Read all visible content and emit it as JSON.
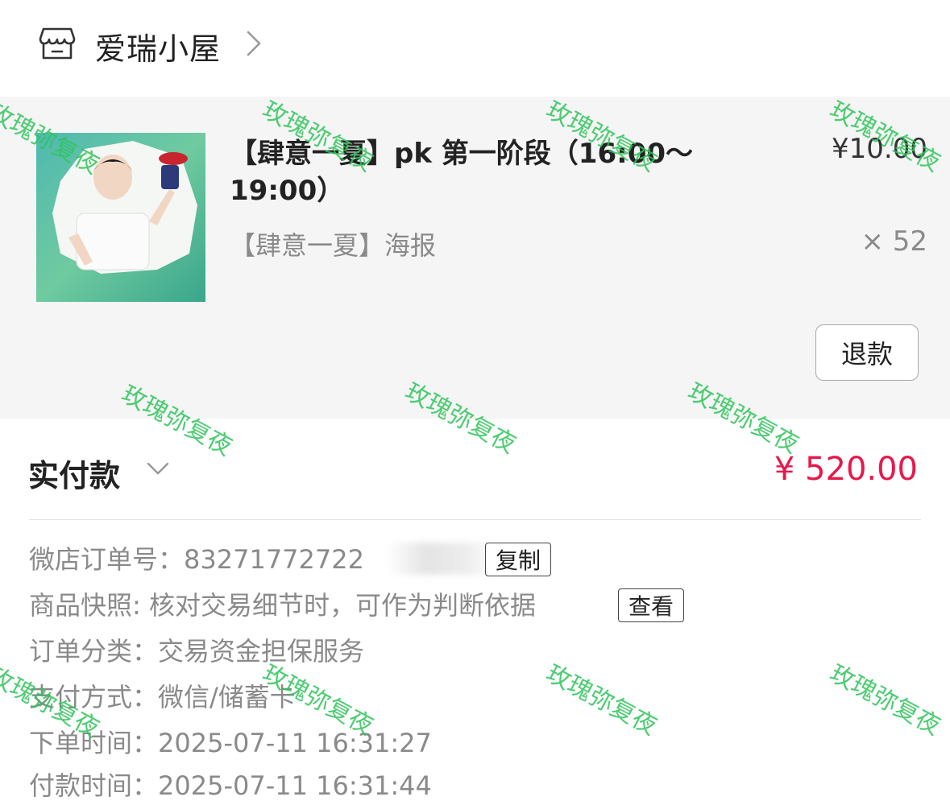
{
  "shop": {
    "name": "爱瑞小屋"
  },
  "product": {
    "title": "【肆意一夏】pk 第一阶段（16:00～19:00）",
    "price": "¥10.00",
    "spec": "【肆意一夏】海报",
    "quantity": "× 52",
    "refund_label": "退款"
  },
  "payment": {
    "label": "实付款",
    "amount": "¥ 520.00"
  },
  "order_info": {
    "order_no_label": "微店订单号：",
    "order_no_value": "83271772722",
    "copy_label": "复制",
    "snapshot_label": "商品快照:",
    "snapshot_value": "核对交易细节时，可作为判断依据",
    "view_label": "查看",
    "category_label": "订单分类：",
    "category_value": "交易资金担保服务",
    "pay_method_label": "支付方式：",
    "pay_method_value": "微信/储蓄卡",
    "order_time_label": "下单时间：",
    "order_time_value": "2025-07-11 16:31:27",
    "pay_time_label": "付款时间：",
    "pay_time_value": "2025-07-11 16:31:44"
  },
  "watermark": "玫瑰弥复夜",
  "colors": {
    "accent": "#e6194b",
    "watermark": "#2fc45a",
    "panel_bg": "#f5f5f5"
  }
}
